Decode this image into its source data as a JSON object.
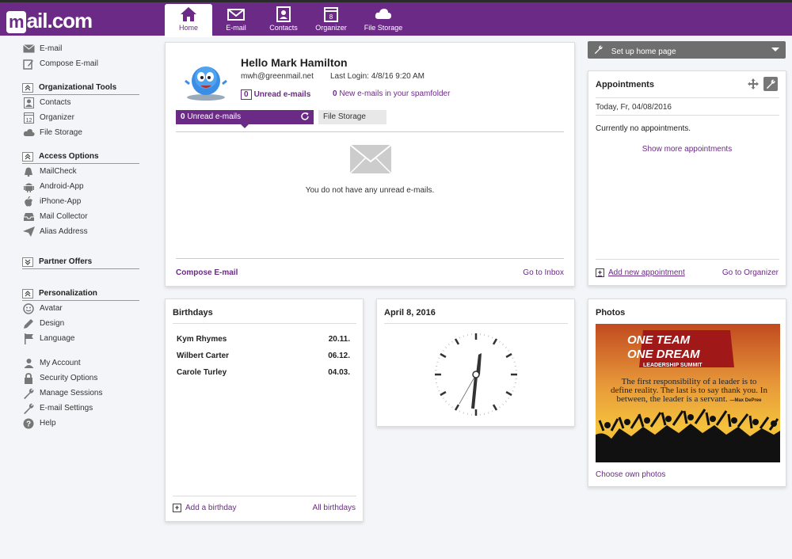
{
  "brand": {
    "logo_m": "m",
    "logo_text": "ail.com",
    "accent": "#6b2a86"
  },
  "nav": [
    {
      "label": "Home",
      "icon": "home-icon"
    },
    {
      "label": "E-mail",
      "icon": "envelope-icon"
    },
    {
      "label": "Contacts",
      "icon": "contacts-icon"
    },
    {
      "label": "Organizer",
      "icon": "calendar-icon",
      "badge": "8"
    },
    {
      "label": "File Storage",
      "icon": "cloud-icon"
    }
  ],
  "sidebar": {
    "top": [
      {
        "label": "E-mail",
        "icon": "envelope-icon"
      },
      {
        "label": "Compose E-mail",
        "icon": "compose-icon"
      }
    ],
    "org": {
      "title": "Organizational Tools",
      "items": [
        {
          "label": "Contacts",
          "icon": "contacts-icon"
        },
        {
          "label": "Organizer",
          "icon": "calendar-icon"
        },
        {
          "label": "File Storage",
          "icon": "cloud-icon"
        }
      ]
    },
    "access": {
      "title": "Access Options",
      "items": [
        {
          "label": "MailCheck",
          "icon": "bell-icon"
        },
        {
          "label": "Android-App",
          "icon": "android-icon"
        },
        {
          "label": "iPhone-App",
          "icon": "apple-icon"
        },
        {
          "label": "Mail Collector",
          "icon": "inbox-icon"
        },
        {
          "label": "Alias Address",
          "icon": "paper-plane-icon"
        }
      ]
    },
    "partner": {
      "title": "Partner Offers"
    },
    "personal": {
      "title": "Personalization",
      "items": [
        {
          "label": "Avatar",
          "icon": "smiley-icon"
        },
        {
          "label": "Design",
          "icon": "pen-icon"
        },
        {
          "label": "Language",
          "icon": "flag-icon"
        }
      ]
    },
    "account": [
      {
        "label": "My Account",
        "icon": "user-icon"
      },
      {
        "label": "Security Options",
        "icon": "lock-icon"
      },
      {
        "label": "Manage Sessions",
        "icon": "wrench-icon"
      },
      {
        "label": "E-mail Settings",
        "icon": "wrench-icon"
      },
      {
        "label": "Help",
        "icon": "help-icon"
      }
    ]
  },
  "mail": {
    "greeting": "Hello Mark Hamilton",
    "email": "mwh@greenmail.net",
    "last_login": "Last Login: 4/8/16 9:20 AM",
    "unread_count": "0",
    "unread_label": "Unread e-mails",
    "spam_count": "0",
    "spam_label": "New e-mails in your spamfolder",
    "tab_unread_count": "0",
    "tab_unread_label": "Unread e-mails",
    "tab_file_storage": "File Storage",
    "no_mail": "You do not have any unread e-mails.",
    "compose": "Compose E-mail",
    "goto_inbox": "Go to Inbox"
  },
  "setup": {
    "label": "Set up home page"
  },
  "appointments": {
    "title": "Appointments",
    "today": "Today, Fr, 04/08/2016",
    "none": "Currently no appointments.",
    "more": "Show more appointments",
    "add": "Add new appointment",
    "goto": "Go to Organizer"
  },
  "birthdays": {
    "title": "Birthdays",
    "rows": [
      {
        "name": "Kym Rhymes",
        "date": "20.11."
      },
      {
        "name": "Wilbert Carter",
        "date": "06.12."
      },
      {
        "name": "Carole Turley",
        "date": "04.03."
      }
    ],
    "add": "Add a birthday",
    "all": "All birthdays"
  },
  "clock": {
    "title": "April 8, 2016"
  },
  "photos": {
    "title": "Photos",
    "line1": "ONE TEAM",
    "line2": "ONE DREAM",
    "line3": "LEADERSHIP SUMMIT",
    "quote": "The first responsibility of a leader is to define reality. The last is to say thank you. In between, the leader is a servant.",
    "quote_author": "—Max DePree",
    "choose": "Choose own photos"
  }
}
